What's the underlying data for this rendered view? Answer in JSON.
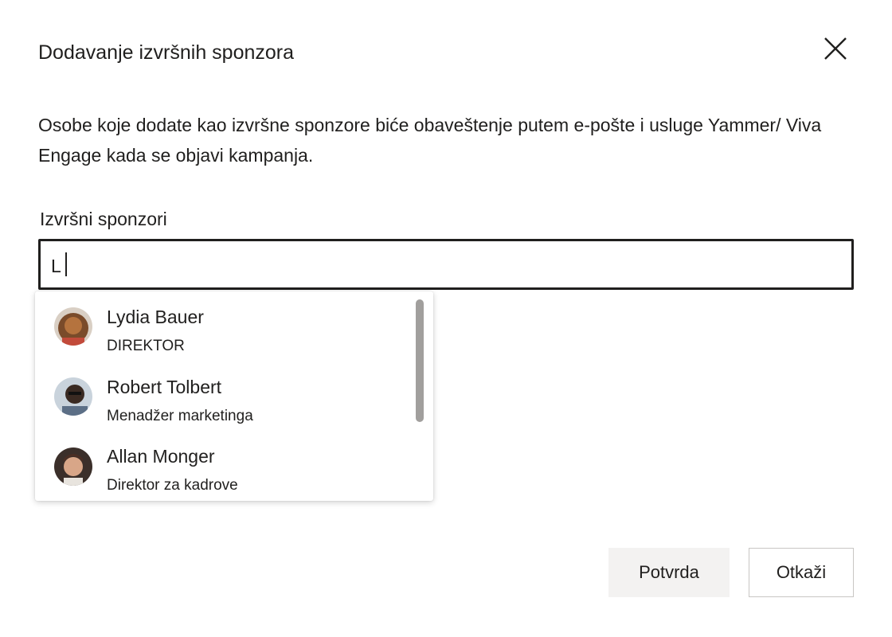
{
  "dialog": {
    "title": "Dodavanje izvršnih sponzora",
    "description": "Osobe koje dodate kao izvršne sponzore biće obaveštenje putem e-pošte i usluge Yammer/ Viva Engage kada se objavi kampanja.",
    "field_label": "Izvršni sponzori",
    "input_value": "L",
    "close_icon": "close-icon"
  },
  "suggestions": [
    {
      "name": "Lydia Bauer",
      "role": "DIREKTOR",
      "avatar_color": "#b5733e"
    },
    {
      "name": "Robert Tolbert",
      "role": "Menadžer marketinga",
      "avatar_color": "#3a2a22"
    },
    {
      "name": "Allan Monger",
      "role": "Direktor za kadrove",
      "avatar_color": "#4a2e24"
    }
  ],
  "buttons": {
    "confirm": "Potvrda",
    "cancel": "Otkaži"
  },
  "colors": {
    "text": "#201f1e",
    "confirm_bg": "#f3f2f1",
    "scrollbar": "#a19f9d"
  }
}
